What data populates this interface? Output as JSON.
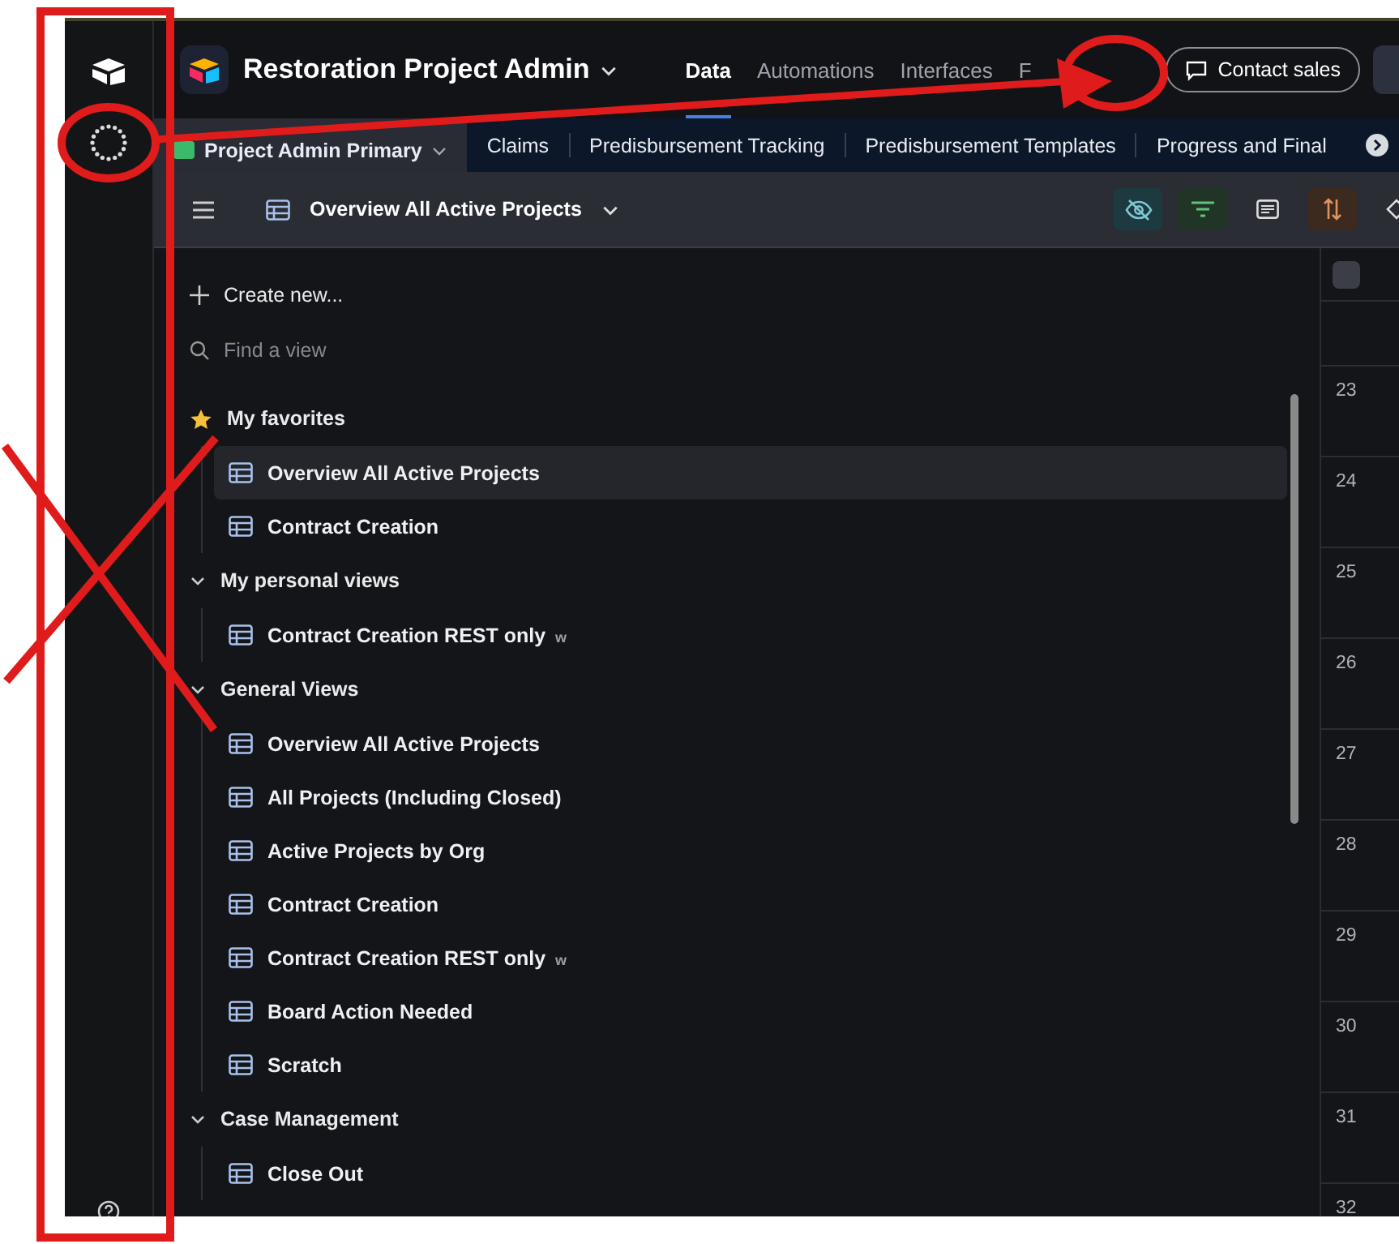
{
  "app": {
    "title": "Restoration Project Admin"
  },
  "nav": [
    {
      "label": "Data",
      "selected": true
    },
    {
      "label": "Automations",
      "selected": false
    },
    {
      "label": "Interfaces",
      "selected": false
    },
    {
      "label": "F",
      "selected": false
    }
  ],
  "contact_button": "Contact sales",
  "tables": [
    {
      "label": "Project Admin Primary",
      "selected": true
    },
    {
      "label": "Claims",
      "selected": false
    },
    {
      "label": "Predisbursement Tracking",
      "selected": false
    },
    {
      "label": "Predisbursement Templates",
      "selected": false
    },
    {
      "label": "Progress and Final",
      "selected": false
    }
  ],
  "view_bar": {
    "title": "Overview All Active Projects",
    "fields_hidden": true,
    "filtered": true,
    "sorted": true
  },
  "sidebar": {
    "create": "Create new...",
    "search": {
      "placeholder": "Find a view"
    },
    "groups": [
      {
        "kind": "favorites",
        "label": "My favorites",
        "expanded": true,
        "views": [
          {
            "label": "Overview All Active Projects",
            "selected": true
          },
          {
            "label": "Contract Creation",
            "selected": false
          }
        ]
      },
      {
        "kind": "section",
        "label": "My personal views",
        "expanded": true,
        "views": [
          {
            "label": "Contract Creation REST only",
            "badge": "w",
            "selected": false
          }
        ]
      },
      {
        "kind": "section",
        "label": "General Views",
        "expanded": true,
        "views": [
          {
            "label": "Overview All Active Projects",
            "selected": false
          },
          {
            "label": "All Projects (Including Closed)",
            "selected": false
          },
          {
            "label": "Active Projects by Org",
            "selected": false
          },
          {
            "label": "Contract Creation",
            "selected": false
          },
          {
            "label": "Contract Creation REST only",
            "badge": "w",
            "selected": false
          },
          {
            "label": "Board Action Needed",
            "selected": false
          },
          {
            "label": "Scratch",
            "selected": false
          }
        ]
      },
      {
        "kind": "section",
        "label": "Case Management",
        "expanded": true,
        "views": [
          {
            "label": "Close Out",
            "selected": false
          }
        ]
      }
    ]
  },
  "grid": {
    "all_selected": false,
    "rows": [
      "23",
      "24",
      "25",
      "26",
      "27",
      "28",
      "29",
      "30",
      "31",
      "32"
    ]
  }
}
